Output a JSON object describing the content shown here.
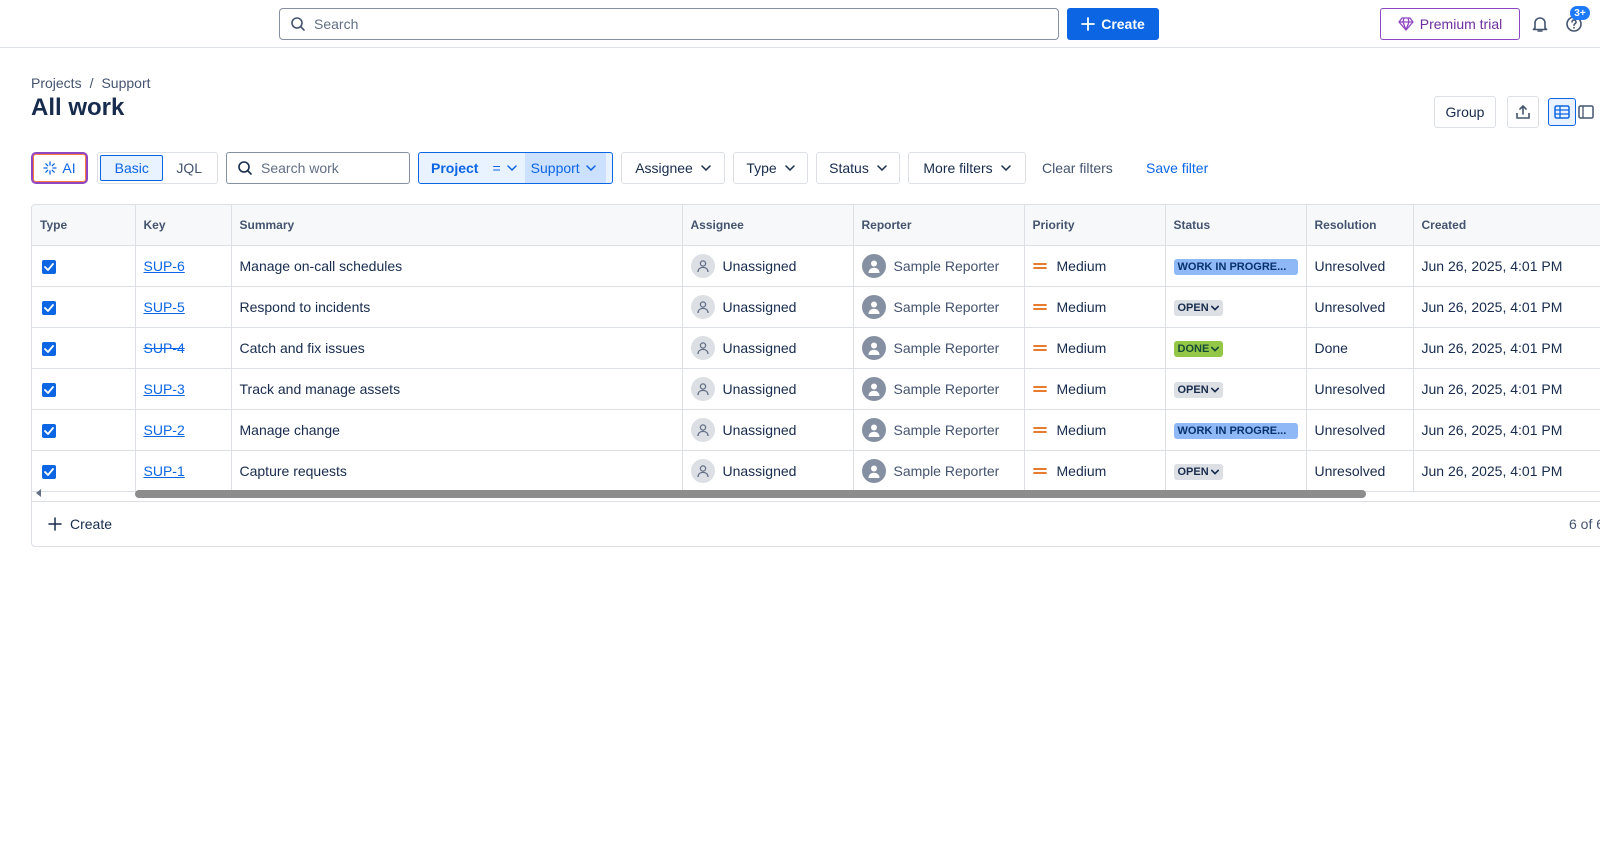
{
  "topbar": {
    "search_placeholder": "Search",
    "create_label": "Create",
    "premium_label": "Premium trial",
    "notification_badge": "3+"
  },
  "header": {
    "breadcrumb": [
      "Projects",
      "Support"
    ],
    "title": "All work",
    "group_label": "Group"
  },
  "filters": {
    "ai_label": "AI",
    "mode_basic": "Basic",
    "mode_jql": "JQL",
    "search_placeholder": "Search work",
    "project_label": "Project",
    "project_operator": "=",
    "project_value": "Support",
    "assignee_label": "Assignee",
    "type_label": "Type",
    "status_label": "Status",
    "more_label": "More filters",
    "clear_label": "Clear filters",
    "save_label": "Save filter"
  },
  "table": {
    "columns": [
      "Type",
      "Key",
      "Summary",
      "Assignee",
      "Reporter",
      "Priority",
      "Status",
      "Resolution",
      "Created"
    ],
    "rows": [
      {
        "key": "SUP-6",
        "summary": "Manage on-call schedules",
        "assignee": "Unassigned",
        "reporter": "Sample Reporter",
        "priority": "Medium",
        "status": "WORK IN PROGRE...",
        "resolution": "Unresolved",
        "created": "Jun 26, 2025, 4:01 PM"
      },
      {
        "key": "SUP-5",
        "summary": "Respond to incidents",
        "assignee": "Unassigned",
        "reporter": "Sample Reporter",
        "priority": "Medium",
        "status": "OPEN",
        "resolution": "Unresolved",
        "created": "Jun 26, 2025, 4:01 PM"
      },
      {
        "key": "SUP-4",
        "summary": "Catch and fix issues",
        "assignee": "Unassigned",
        "reporter": "Sample Reporter",
        "priority": "Medium",
        "status": "DONE",
        "resolution": "Done",
        "created": "Jun 26, 2025, 4:01 PM"
      },
      {
        "key": "SUP-3",
        "summary": "Track and manage assets",
        "assignee": "Unassigned",
        "reporter": "Sample Reporter",
        "priority": "Medium",
        "status": "OPEN",
        "resolution": "Unresolved",
        "created": "Jun 26, 2025, 4:01 PM"
      },
      {
        "key": "SUP-2",
        "summary": "Manage change",
        "assignee": "Unassigned",
        "reporter": "Sample Reporter",
        "priority": "Medium",
        "status": "WORK IN PROGRE...",
        "resolution": "Unresolved",
        "created": "Jun 26, 2025, 4:01 PM"
      },
      {
        "key": "SUP-1",
        "summary": "Capture requests",
        "assignee": "Unassigned",
        "reporter": "Sample Reporter",
        "priority": "Medium",
        "status": "OPEN",
        "resolution": "Unresolved",
        "created": "Jun 26, 2025, 4:01 PM"
      }
    ],
    "footer_create": "Create",
    "footer_count": "6 of 6"
  },
  "colors": {
    "accent": "#0c66e4",
    "status_wip": "#8fb8f6",
    "status_open": "#dcdfe4",
    "status_done": "#94c748",
    "priority_medium": "#e56910"
  },
  "icons": [
    "search-icon",
    "plus-icon",
    "diamond-icon",
    "bell-icon",
    "help-icon",
    "sparkle-icon",
    "chevron-down-icon",
    "export-icon",
    "list-view-icon",
    "detail-view-icon",
    "checkbox-icon",
    "person-icon",
    "priority-medium-icon"
  ]
}
